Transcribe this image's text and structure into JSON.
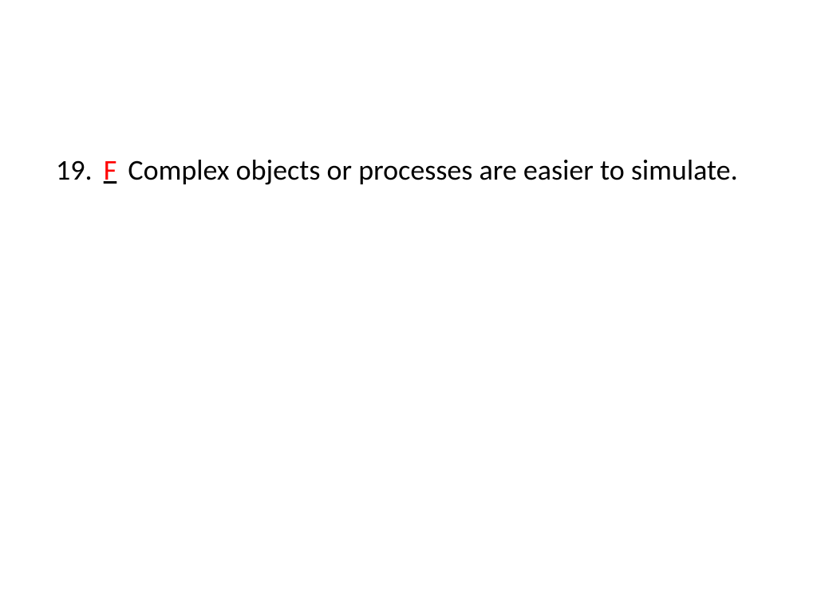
{
  "question": {
    "number": "19.",
    "answer": "F",
    "text_part1": "Complex objects or processes are easier to simulate."
  }
}
